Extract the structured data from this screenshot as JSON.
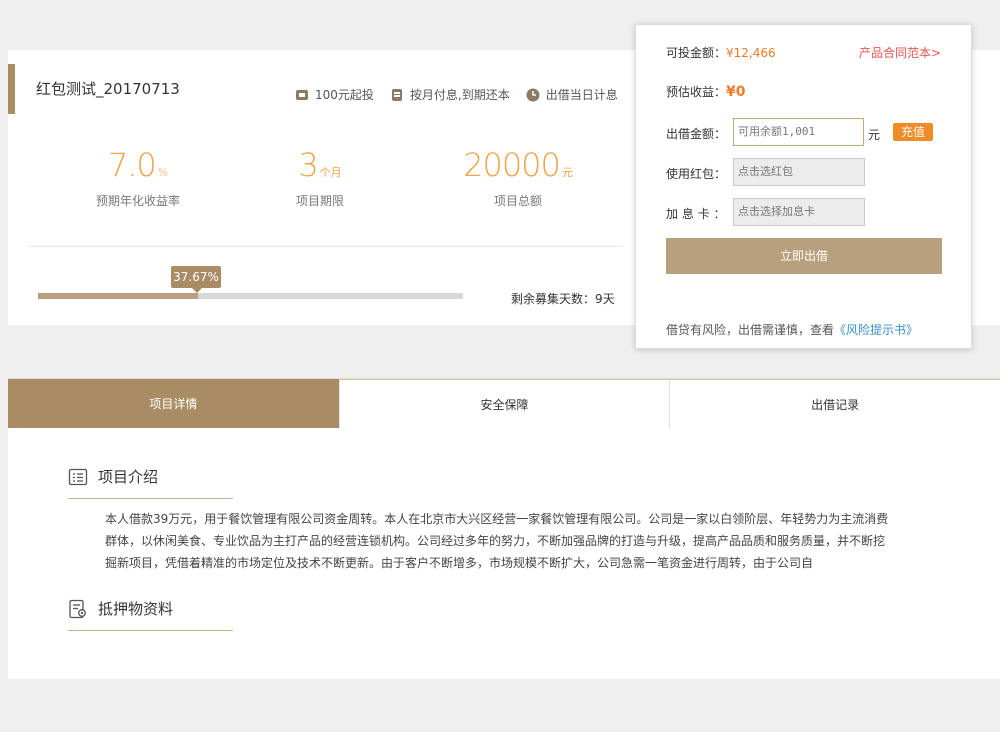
{
  "project": {
    "title": "红包测试_20170713",
    "tags": [
      {
        "icon": "coin-stack-icon",
        "label": "100元起投"
      },
      {
        "icon": "calendar-icon",
        "label": "按月付息,到期还本"
      },
      {
        "icon": "clock-icon",
        "label": "出借当日计息"
      }
    ],
    "stats": {
      "rate": {
        "value": "7.0",
        "unit": "%",
        "label": "预期年化收益率"
      },
      "term": {
        "value": "3",
        "unit": "个月",
        "label": "项目期限"
      },
      "amount": {
        "value": "20000",
        "unit": "元",
        "label": "项目总额"
      }
    },
    "progress": {
      "percent_label": "37.67%",
      "percent": 37.67
    },
    "remain_days": "剩余募集天数：9天"
  },
  "invest": {
    "available_label": "可投金额：",
    "available_value": "¥12,466",
    "contract_link": "产品合同范本>",
    "estimate_label": "预估收益：",
    "estimate_value": "¥0",
    "amount_label": "出借金额：",
    "amount_placeholder": "可用余额1,001",
    "unit": "元",
    "recharge": "充值",
    "redpacket_label": "使用红包：",
    "redpacket_placeholder": "点击选红包",
    "card_label": "加 息 卡 ：",
    "card_placeholder": "点击选择加息卡",
    "submit": "立即出借",
    "risk_text": "借贷有风险，出借需谨慎，查看",
    "risk_link": "《风险提示书》"
  },
  "tabs": [
    "项目详情",
    "安全保障",
    "出借记录"
  ],
  "detail": {
    "intro_title": "项目介绍",
    "intro_text": "本人借款39万元，用于餐饮管理有限公司资金周转。本人在北京市大兴区经营一家餐饮管理有限公司。公司是一家以白领阶层、年轻势力为主流消费群体，以休闲美食、专业饮品为主打产品的经营连锁机构。公司经过多年的努力，不断加强品牌的打造与升级，提高产品品质和服务质量，并不断挖掘新项目，凭借着精准的市场定位及技术不断更新。由于客户不断增多，市场规模不断扩大，公司急需一笔资金进行周转，由于公司自",
    "collateral_title": "抵押物资料"
  },
  "colors": {
    "accent": "#a98c63",
    "orange": "#f07a26",
    "link": "#3c8ec8"
  }
}
